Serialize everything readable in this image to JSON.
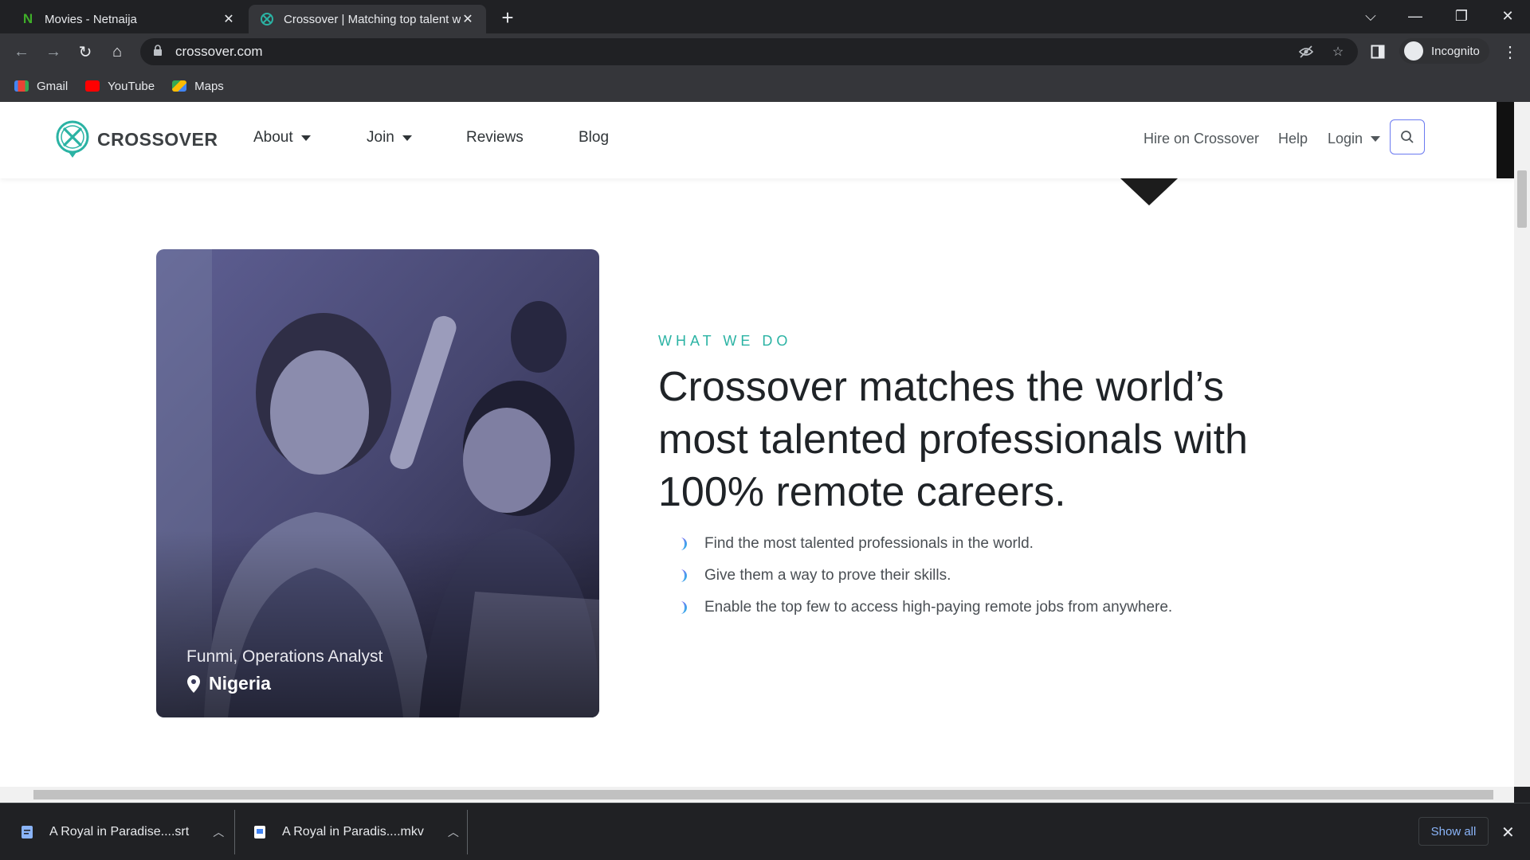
{
  "browser": {
    "tabs": [
      {
        "title": "Movies - Netnaija",
        "favicon": "netnaija-n-icon",
        "active": false
      },
      {
        "title": "Crossover | Matching top talent w",
        "favicon": "crossover-icon",
        "active": true
      }
    ],
    "url": "crossover.com",
    "profile_label": "Incognito",
    "bookmarks": [
      {
        "label": "Gmail",
        "icon": "gmail-icon"
      },
      {
        "label": "YouTube",
        "icon": "youtube-icon"
      },
      {
        "label": "Maps",
        "icon": "maps-icon"
      }
    ]
  },
  "site": {
    "logo_text": "CROSSOVER",
    "nav": {
      "about": "About",
      "join": "Join",
      "reviews": "Reviews",
      "blog": "Blog",
      "hire": "Hire on Crossover",
      "help": "Help",
      "login": "Login"
    },
    "photo": {
      "caption_name": "Funmi, Operations Analyst",
      "caption_location": "Nigeria"
    },
    "section": {
      "eyebrow": "WHAT WE DO",
      "headline": "Crossover matches the world’s most talented professionals with 100% remote careers.",
      "bullets": [
        "Find the most talented professionals in the world.",
        "Give them a way to prove their skills.",
        "Enable the top few to access high-paying remote jobs from anywhere."
      ]
    }
  },
  "downloads": {
    "items": [
      {
        "name": "A Royal in Paradise....srt"
      },
      {
        "name": "A Royal in Paradis....mkv"
      }
    ],
    "show_all": "Show all"
  },
  "colors": {
    "accent_teal": "#2bb3a4",
    "search_border": "#6b7af0",
    "chrome_dark": "#202124",
    "chrome_toolbar": "#35363a"
  }
}
